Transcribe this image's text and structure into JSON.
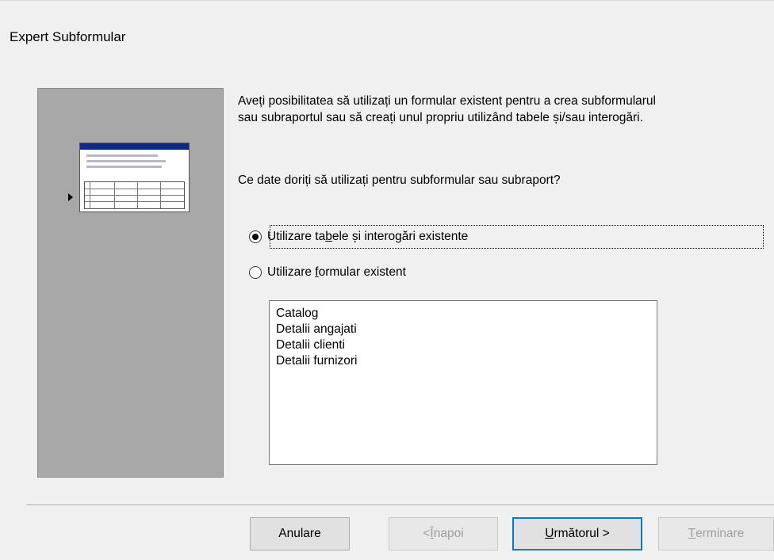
{
  "dialog": {
    "title": "Expert Subformular"
  },
  "content": {
    "description_line1": "Aveți posibilitatea să utilizați un formular existent pentru a crea subformularul",
    "description_line2": "sau subraportul sau să creați unul propriu utilizând tabele și/sau interogări.",
    "question": "Ce date doriți să utilizați pentru subformular sau subraport?"
  },
  "options": [
    {
      "pre": "Utilizare ta",
      "accel": "b",
      "post": "ele și interogări existente",
      "checked": true
    },
    {
      "pre": "Utilizare ",
      "accel": "f",
      "post": "ormular existent",
      "checked": false
    }
  ],
  "forms_list": [
    "Catalog",
    "Detalii angajati",
    "Detalii clienti",
    "Detalii furnizori"
  ],
  "buttons": {
    "cancel": {
      "pre": "Anulare",
      "accel": "",
      "post": ""
    },
    "back": {
      "pre": "< ",
      "accel": "Î",
      "post": "napoi"
    },
    "next": {
      "pre": "",
      "accel": "U",
      "post": "rmătorul >"
    },
    "finish": {
      "pre": "",
      "accel": "T",
      "post": "erminare"
    }
  },
  "colors": {
    "dialog_bg": "#f0f0f0",
    "preview_bg": "#a8a8a8",
    "accent_focus": "#0078d7",
    "thumb_titlebar": "#0a2a8c"
  }
}
